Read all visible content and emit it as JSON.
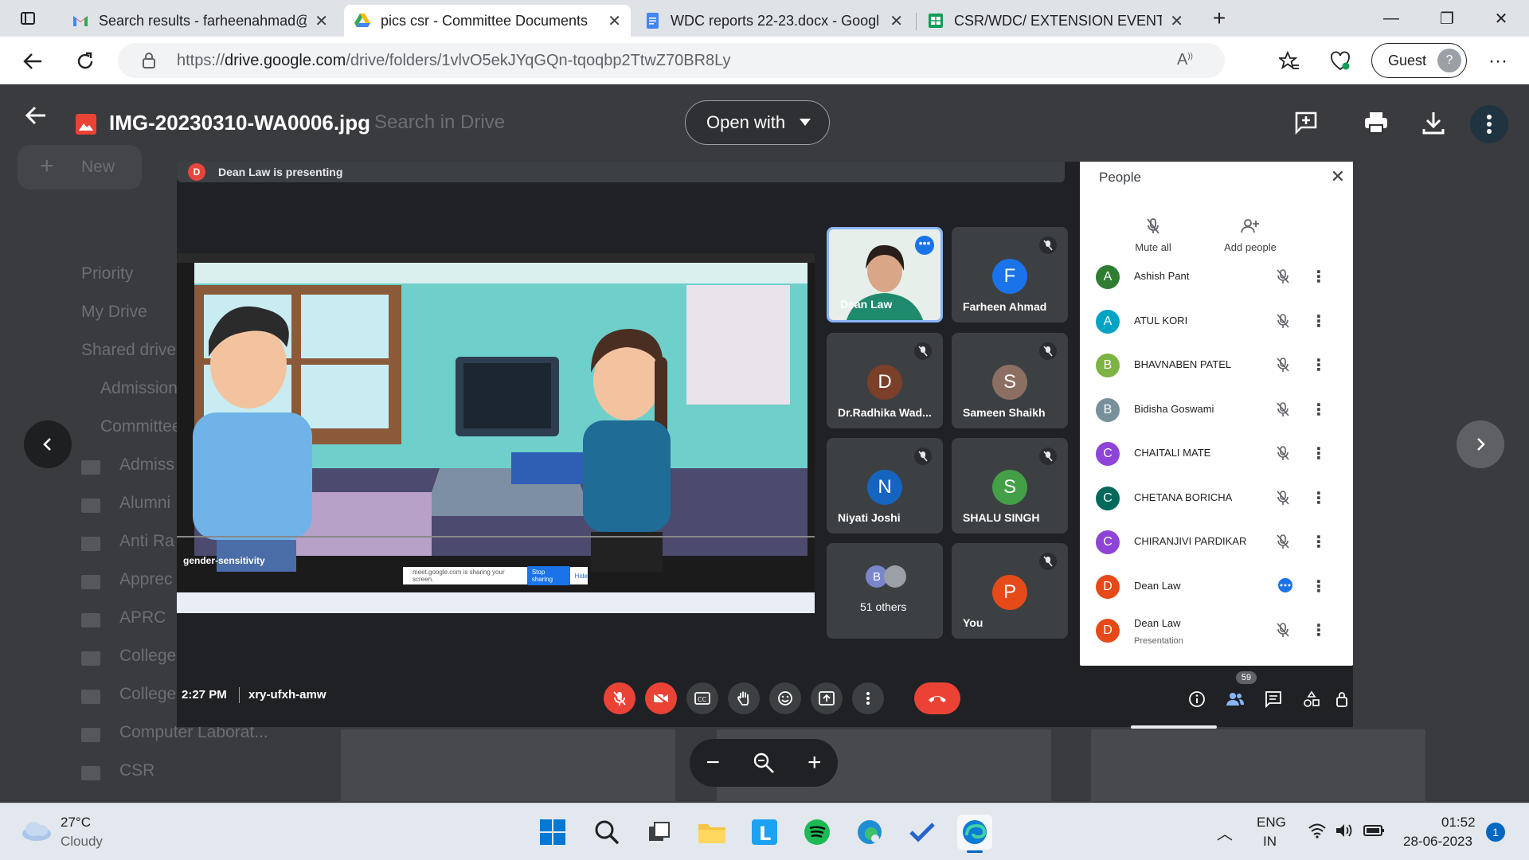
{
  "browser": {
    "tabs": [
      {
        "title": "Search results - farheenahmad@",
        "icon": "gmail-icon"
      },
      {
        "title": "pics csr - Committee Documents",
        "icon": "drive-icon",
        "active": true
      },
      {
        "title": "WDC reports 22-23.docx - Googl",
        "icon": "docs-icon"
      },
      {
        "title": "CSR/WDC/ EXTENSION EVENTS",
        "icon": "sheets-icon"
      }
    ],
    "url_prefix": "https://",
    "url_host": "drive.google.com",
    "url_path": "/drive/folders/1vlvO5ekJYqGQn-tqoqbp2TtwZ70BR8Ly",
    "profile_label": "Guest"
  },
  "drive_bg": {
    "search_placeholder": "Search in Drive",
    "new_label": "New",
    "nav": [
      "Priority",
      "My Drive",
      "Shared drives"
    ],
    "folders": [
      "Admission",
      "Committee",
      "Admiss",
      "Alumni",
      "Anti Ra",
      "Apprec",
      "APRC",
      "College",
      "College",
      "Computer Laborat...",
      "CSR"
    ]
  },
  "viewer": {
    "file_name": "IMG-20230310-WA0006.jpg",
    "open_with_label": "Open with"
  },
  "meet": {
    "presenting_text": "Dean Law is presenting",
    "presenter_initial": "D",
    "video_caption": "gender-sensitivity",
    "sharing_banner_text": "meet.google.com is sharing your screen.",
    "stop_sharing_label": "Stop sharing",
    "hide_label": "Hide",
    "tiles": [
      {
        "name": "Dean Law",
        "initial": "",
        "color": "#1a8a6e"
      },
      {
        "name": "Farheen Ahmad",
        "initial": "F",
        "color": "#1a73e8"
      },
      {
        "name": "Dr.Radhika Wad...",
        "initial": "D",
        "color": "#7b3f2a"
      },
      {
        "name": "Sameen Shaikh",
        "initial": "S",
        "color": "#8d6e63"
      },
      {
        "name": "Niyati Joshi",
        "initial": "N",
        "color": "#1565c0"
      },
      {
        "name": "SHALU SINGH",
        "initial": "S",
        "color": "#43a047"
      },
      {
        "name": "51 others",
        "initial": "B",
        "color": "#7986cb"
      },
      {
        "name": "You",
        "initial": "P",
        "color": "#e64a19"
      }
    ],
    "people_panel": {
      "title": "People",
      "mute_all_label": "Mute all",
      "add_people_label": "Add people",
      "participants": [
        {
          "name": "Ashish Pant",
          "initial": "A",
          "color": "#2e7d32"
        },
        {
          "name": "ATUL KORI",
          "initial": "A",
          "color": "#00a3c4"
        },
        {
          "name": "BHAVNABEN PATEL",
          "initial": "B",
          "color": "#7cb342"
        },
        {
          "name": "Bidisha Goswami",
          "initial": "B",
          "color": "#78909c"
        },
        {
          "name": "CHAITALI MATE",
          "initial": "C",
          "color": "#8e44d6"
        },
        {
          "name": "CHETANA BORICHA",
          "initial": "C",
          "color": "#00695c"
        },
        {
          "name": "CHIRANJIVI PARDIKAR",
          "initial": "C",
          "color": "#8e44d6"
        },
        {
          "name": "Dean Law",
          "initial": "D",
          "color": "#e64a19"
        },
        {
          "name": "Dean Law",
          "initial": "D",
          "color": "#e64a19",
          "sub": "Presentation"
        }
      ]
    },
    "time": "2:27 PM",
    "meeting_code": "xry-ufxh-amw",
    "people_count": "59"
  },
  "taskbar": {
    "temperature": "27°C",
    "weather": "Cloudy",
    "lang_line1": "ENG",
    "lang_line2": "IN",
    "time": "01:52",
    "date": "28-06-2023",
    "notification_count": "1"
  }
}
